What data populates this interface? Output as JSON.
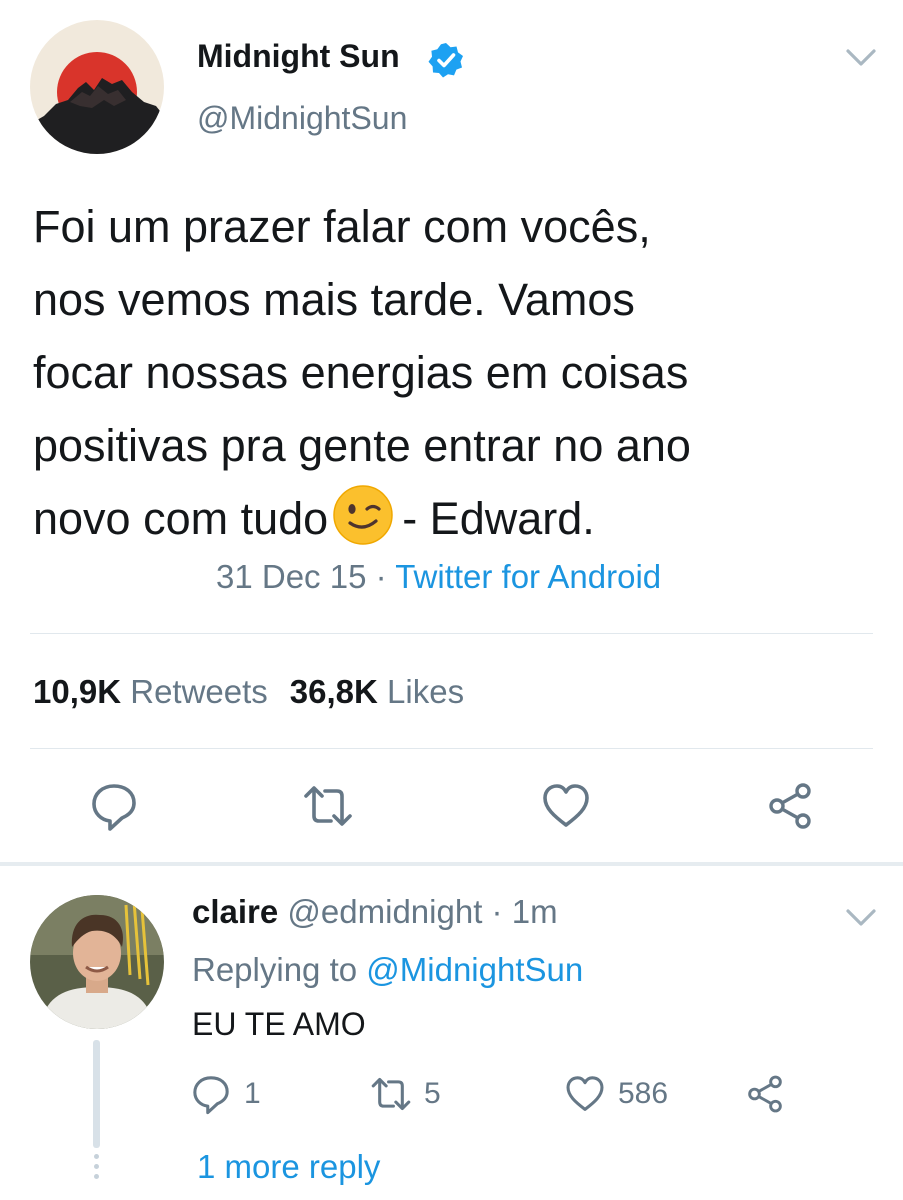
{
  "tweet": {
    "author_name": "Midnight Sun",
    "author_handle": "@MidnightSun",
    "verified": true,
    "text_lines": [
      "Foi um prazer falar com vocês,",
      "nos vemos mais tarde. Vamos",
      "focar nossas energias em coisas",
      "positivas pra gente entrar no ano",
      "novo com tudo"
    ],
    "text_after_emoji": "- Edward.",
    "emoji": "winking-face-icon",
    "date": "31 Dec 15",
    "separator": "·",
    "source": "Twitter for Android",
    "retweets_count": "10,9K",
    "retweets_label": "Retweets",
    "likes_count": "36,8K",
    "likes_label": "Likes"
  },
  "actions": [
    "reply-icon",
    "retweet-icon",
    "like-icon",
    "share-icon"
  ],
  "reply": {
    "author_name": "claire",
    "author_handle": "@edmidnight",
    "separator": "·",
    "time": "1m",
    "replying_label": "Replying to",
    "replying_handle": "@MidnightSun",
    "text": "EU TE AMO",
    "reply_count": "1",
    "retweet_count": "5",
    "like_count": "586",
    "more_replies": "1 more reply"
  },
  "colors": {
    "text": "#14171a",
    "secondary": "#657786",
    "link": "#1b95e0",
    "verified": "#1da1f2",
    "divider": "#e1e8ed",
    "avatar_sun": "#d9342b",
    "avatar_bg": "#f1e9dc"
  }
}
